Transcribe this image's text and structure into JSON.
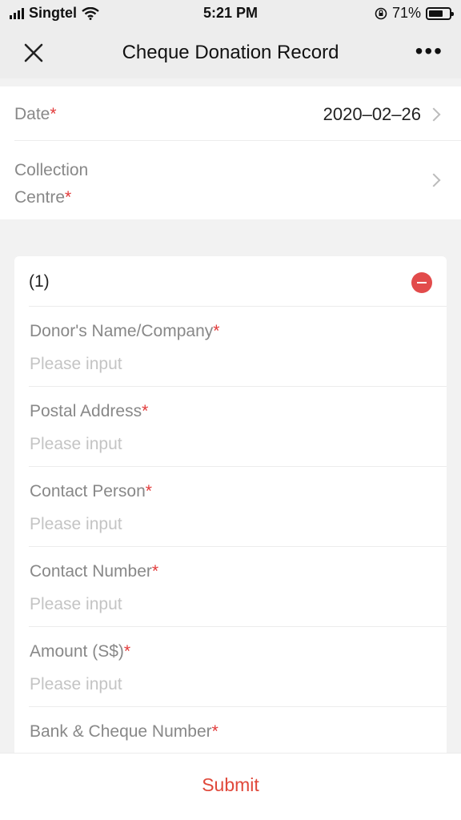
{
  "status": {
    "carrier": "Singtel",
    "time": "5:21 PM",
    "battery": "71%",
    "battery_level": 0.71
  },
  "nav": {
    "title": "Cheque Donation Record",
    "more": "•••"
  },
  "top": {
    "date_label": "Date",
    "date_value": "2020–02–26",
    "centre_label_line1": "Collection",
    "centre_label_line2": "Centre",
    "required_mark": "*"
  },
  "card": {
    "index": "(1)",
    "fields": [
      {
        "label": "Donor's Name/Company",
        "placeholder": "Please input"
      },
      {
        "label": "Postal Address",
        "placeholder": "Please input"
      },
      {
        "label": "Contact Person",
        "placeholder": "Please input"
      },
      {
        "label": "Contact Number",
        "placeholder": "Please input"
      },
      {
        "label": "Amount (S$)",
        "placeholder": "Please input"
      },
      {
        "label": "Bank & Cheque Number",
        "placeholder": ""
      }
    ]
  },
  "footer": {
    "submit_label": "Submit"
  },
  "colors": {
    "accent": "#e0483a",
    "required": "#e23a3a",
    "remove": "#e24b4b"
  }
}
